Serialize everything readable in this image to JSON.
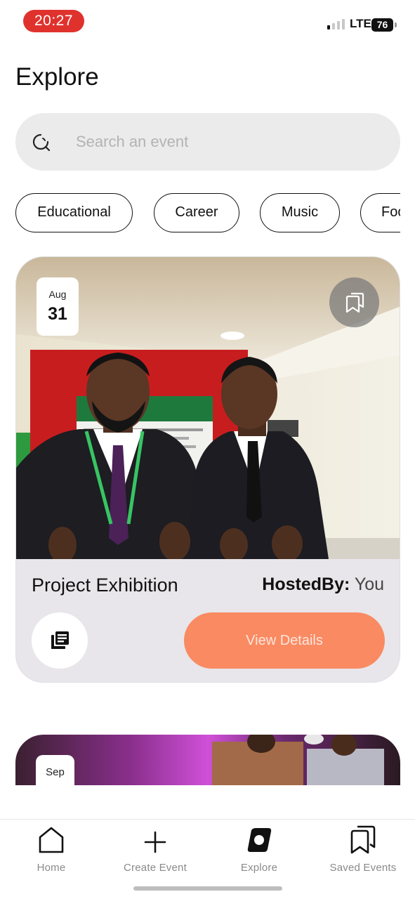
{
  "status_bar": {
    "time": "20:27",
    "network": "LTE",
    "battery": "76"
  },
  "page": {
    "title": "Explore"
  },
  "search": {
    "placeholder": "Search an event",
    "icon": "search-icon"
  },
  "categories": [
    "Educational",
    "Career",
    "Music",
    "Food"
  ],
  "events": [
    {
      "month": "Aug",
      "day": "31",
      "title": "Project Exhibition",
      "hosted_by_label": "HostedBy:",
      "hosted_by_value": "You",
      "details_label": "View Details",
      "accent_color": "#fa8a62"
    },
    {
      "month": "Sep"
    }
  ],
  "nav": {
    "items": [
      {
        "label": "Home",
        "icon": "home-icon"
      },
      {
        "label": "Create Event",
        "icon": "plus-icon"
      },
      {
        "label": "Explore",
        "icon": "explore-icon"
      },
      {
        "label": "Saved Events",
        "icon": "saved-icon"
      }
    ]
  }
}
